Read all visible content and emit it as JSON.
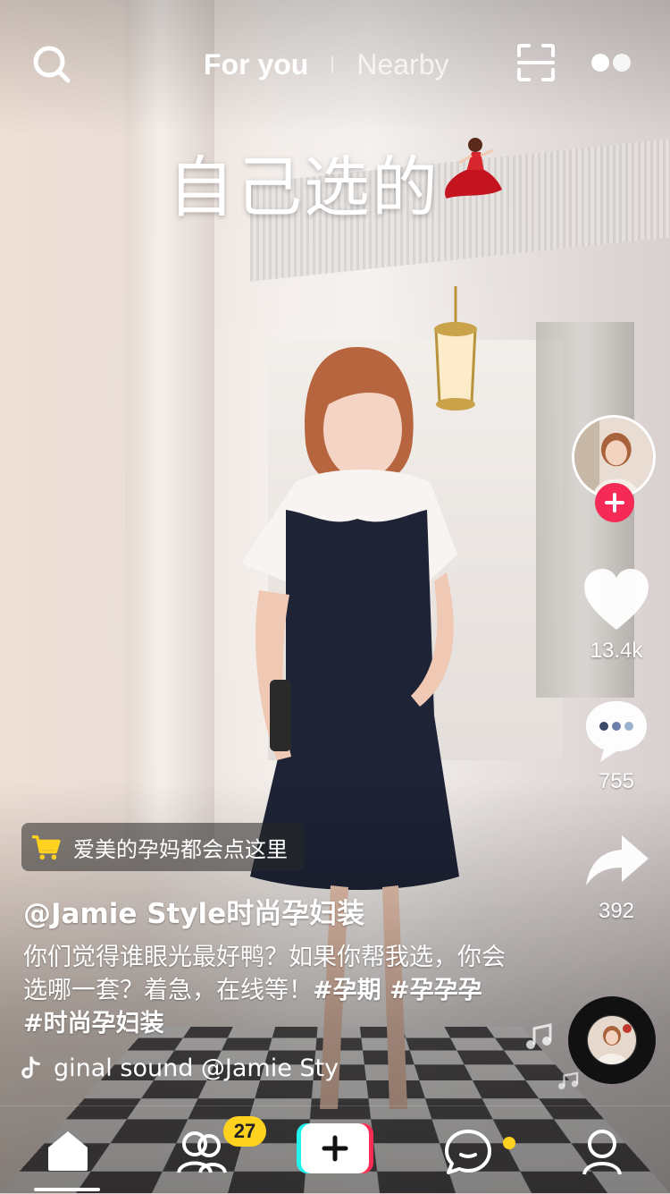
{
  "top_bar": {
    "tabs": [
      "For you",
      "Nearby"
    ],
    "active_tab": "For you"
  },
  "video": {
    "overlay_caption": "自己选的"
  },
  "right_rail": {
    "likes": "13.4k",
    "comments": "755",
    "shares": "392"
  },
  "info": {
    "shop_tag": "爱美的孕妈都会点这里",
    "author": "@Jamie Style时尚孕妇装",
    "description": "你们觉得谁眼光最好鸭？如果你帮我选，你会选哪一套？着急，在线等！",
    "hashtags": "#孕期 #孕孕孕 #时尚孕妇装",
    "sound": "ginal sound    @Jamie Sty"
  },
  "bottom_nav": {
    "friends_badge": "27"
  },
  "colors": {
    "accent_red": "#f52a57",
    "badge_yellow": "#ffd21f",
    "create_cyan": "#25f4ee",
    "create_pink": "#fe2c55"
  }
}
